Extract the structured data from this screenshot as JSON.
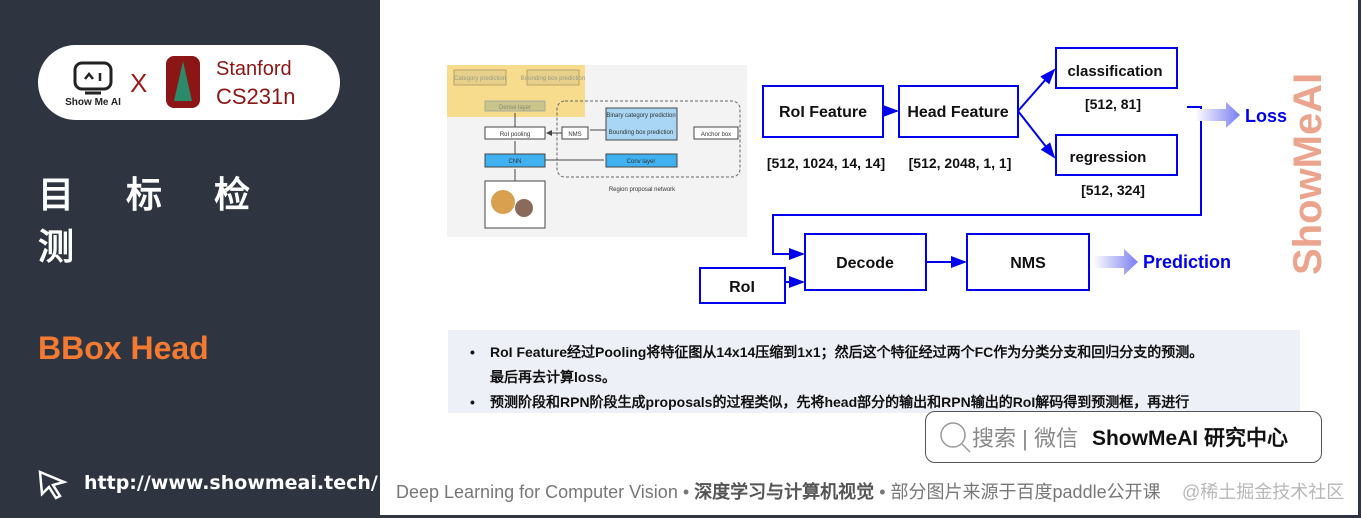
{
  "sidebar": {
    "logo": {
      "showmeai": "Show Me AI",
      "x": "X",
      "stanford": "Stanford",
      "course": "CS231n"
    },
    "title": "目标检测",
    "subtitle": "BBox Head",
    "url": "http://www.showmeai.tech/"
  },
  "diagram": {
    "thumb": {
      "category": "Category prediction",
      "bbox": "Bounding box prediction",
      "dense": "Dense layer",
      "roi_pooling": "RoI pooling",
      "nms": "NMS",
      "binary": "Binary category prediction",
      "bbox2": "Bounding box prediction",
      "anchor": "Anchor box",
      "cnn": "CNN",
      "conv": "Conv layer",
      "rpn": "Region proposal network"
    },
    "roi_feature": "RoI Feature",
    "roi_feature_shape": "[512, 1024, 14, 14]",
    "head_feature": "Head Feature",
    "head_feature_shape": "[512, 2048, 1, 1]",
    "classification": "classification",
    "classification_shape": "[512, 81]",
    "regression": "regression",
    "regression_shape": "[512, 324]",
    "loss": "Loss",
    "roi": "RoI",
    "decode": "Decode",
    "nms": "NMS",
    "prediction": "Prediction",
    "watermark": "ShowMeAI",
    "accent": "#0000ee"
  },
  "bullets": [
    "RoI Feature经过Pooling将特征图从14x14压缩到1x1；然后这个特征经过两个FC作为分类分支和回归分支的预测。",
    "最后再去计算loss。",
    "预测阶段和RPN阶段生成proposals的过程类似，先将head部分的输出和RPN输出的RoI解码得到预测框，再进行"
  ],
  "search": {
    "label": "搜索 | 微信",
    "brand": "ShowMeAI 研究中心"
  },
  "footer": {
    "course": "Deep Learning for Computer Vision",
    "sep": "•",
    "cn": "深度学习与计算机视觉",
    "source": "部分图片来源于百度paddle公开课",
    "watermark": "@稀土掘金技术社区"
  }
}
